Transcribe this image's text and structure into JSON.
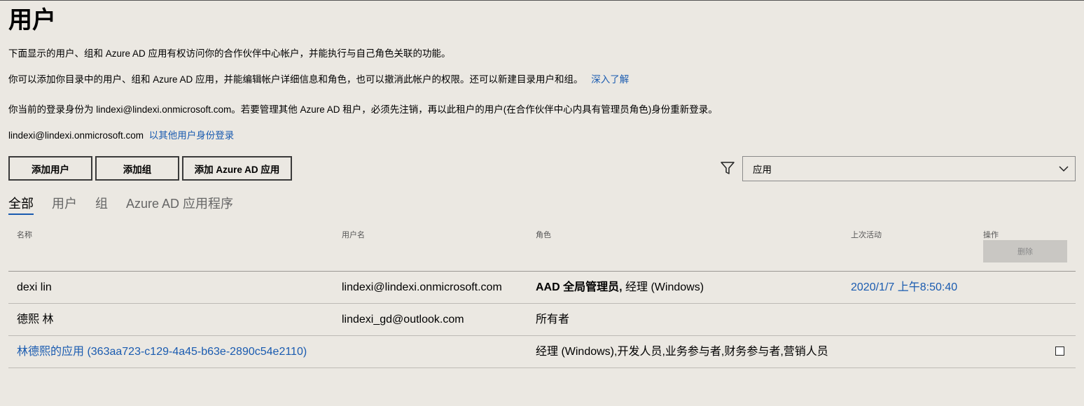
{
  "page": {
    "title": "用户",
    "intro": "下面显示的用户、组和 Azure AD 应用有权访问你的合作伙伴中心帐户，并能执行与自己角色关联的功能。",
    "desc": "你可以添加你目录中的用户、组和 Azure AD 应用，并能编辑帐户详细信息和角色，也可以撤消此帐户的权限。还可以新建目录用户和组。",
    "learn_more": "深入了解",
    "login_notice": "你当前的登录身份为 lindexi@lindexi.onmicrosoft.com。若要管理其他 Azure AD 租户，必须先注销，再以此租户的用户(在合作伙伴中心内具有管理员角色)身份重新登录。",
    "current_user": "lindexi@lindexi.onmicrosoft.com",
    "switch_user": "以其他用户身份登录"
  },
  "toolbar": {
    "add_user": "添加用户",
    "add_group": "添加组",
    "add_app": "添加 Azure AD 应用",
    "filter_icon": "filter-icon",
    "filter_value": "应用"
  },
  "tabs": [
    {
      "label": "全部"
    },
    {
      "label": "用户"
    },
    {
      "label": "组"
    },
    {
      "label": "Azure AD 应用程序"
    }
  ],
  "table": {
    "headers": {
      "name": "名称",
      "username": "用户名",
      "role": "角色",
      "last_active": "上次活动",
      "actions": "操作"
    },
    "delete_label": "删除",
    "rows": [
      {
        "name": "dexi lin",
        "username": "lindexi@lindexi.onmicrosoft.com",
        "role_bold": "AAD 全局管理员,",
        "role": " 经理 (Windows)",
        "last_active": "2020/1/7 上午8:50:40"
      },
      {
        "name": "德熙 林",
        "username": "lindexi_gd@outlook.com",
        "role": "所有者"
      },
      {
        "name": "林德熙的应用 (363aa723-c129-4a45-b63e-2890c54e2110)",
        "role": "经理 (Windows),开发人员,业务参与者,财务参与者,营销人员"
      }
    ]
  },
  "colors": {
    "background": "#ebe8e2",
    "link": "#1a5bb0",
    "disabled_button": "#c9c7c3"
  }
}
